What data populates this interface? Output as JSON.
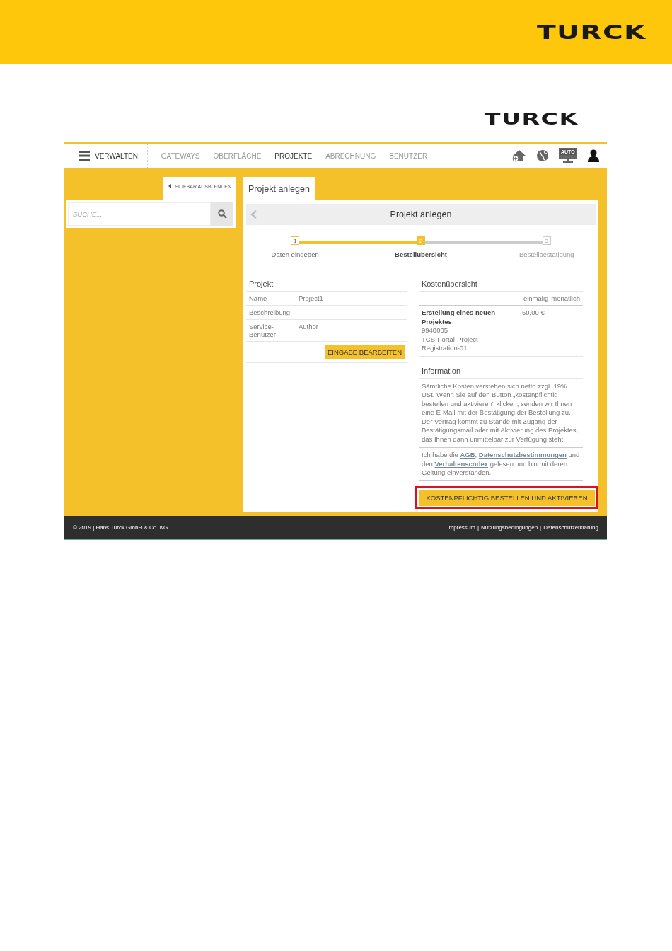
{
  "page_header": {
    "logo": "TURCK"
  },
  "app": {
    "logo": "TURCK",
    "nav": {
      "menu_label": "VERWALTEN:",
      "items": [
        {
          "label": "GATEWAYS",
          "selected": false
        },
        {
          "label": "OBERFLÄCHE",
          "selected": false
        },
        {
          "label": "PROJEKTE",
          "selected": true
        },
        {
          "label": "ABRECHNUNG",
          "selected": false
        },
        {
          "label": "BENUTZER",
          "selected": false
        }
      ],
      "monitor_badge": "AUTO"
    },
    "sidebar": {
      "toggle": "SIDEBAR AUSBLENDEN",
      "search": {
        "placeholder": "SUCHE..."
      }
    },
    "tab": {
      "label": "Projekt anlegen"
    },
    "panel": {
      "title": "Projekt anlegen",
      "steps": [
        {
          "number": "1",
          "label": "Daten eingeben",
          "kind": "done"
        },
        {
          "number": "2",
          "label": "Bestellübersicht",
          "kind": "current"
        },
        {
          "number": "3",
          "label": "Bestellbestätigung",
          "kind": "pending"
        }
      ],
      "project": {
        "heading": "Projekt",
        "rows": [
          {
            "label": "Name",
            "value": "Project1"
          },
          {
            "label": "Beschreibung"
          },
          {
            "label": "Service-Benutzer",
            "value": "Author"
          }
        ],
        "edit_button": "EINGABE BEARBEITEN"
      },
      "costs": {
        "heading": "Kostenübersicht",
        "columns": [
          "einmalig",
          "monatlich"
        ],
        "rows": [
          {
            "title": "Erstellung eines neuen Projektes",
            "lines": [
              "9940005",
              "TCS-Portal-Project-Registration-01"
            ],
            "einmalig": "50,00 €",
            "monatlich": "-"
          }
        ]
      },
      "information": {
        "heading": "Information",
        "text": "Sämtliche Kosten verstehen sich netto zzgl. 19% USt. Wenn Sie auf den Button „kostenpflichtig bestellen und aktivieren“ klicken, senden wir Ihnen eine E-Mail mit der Bestätigung der Bestellung zu. Der Vertrag kommt zu Stande mit Zugang der Bestätigungsmail oder mit Aktivierung des Projektes, das Ihnen dann unmittelbar zur Verfügung steht.",
        "consent": [
          {
            "kind": "text",
            "text": "Ich habe die "
          },
          {
            "kind": "link",
            "text": "AGB"
          },
          {
            "kind": "text",
            "text": ", "
          },
          {
            "kind": "link",
            "text": "Datenschutzbestimmungen"
          },
          {
            "kind": "text",
            "text": " und den "
          },
          {
            "kind": "link",
            "text": "Verhaltenscodex"
          },
          {
            "kind": "text",
            "text": " gelesen und bin mit deren Geltung einverstanden."
          }
        ]
      },
      "order_button": {
        "label": "KOSTENPFLICHTIG BESTELLEN UND AKTIVIEREN",
        "highlighted": true
      }
    },
    "footer": {
      "copyright": "© 2019 | Hans Turck GmbH & Co. KG",
      "links": [
        "Impressum",
        "Nutzungsbedingungen",
        "Datenschutzerklärung"
      ],
      "separator": "|"
    }
  }
}
